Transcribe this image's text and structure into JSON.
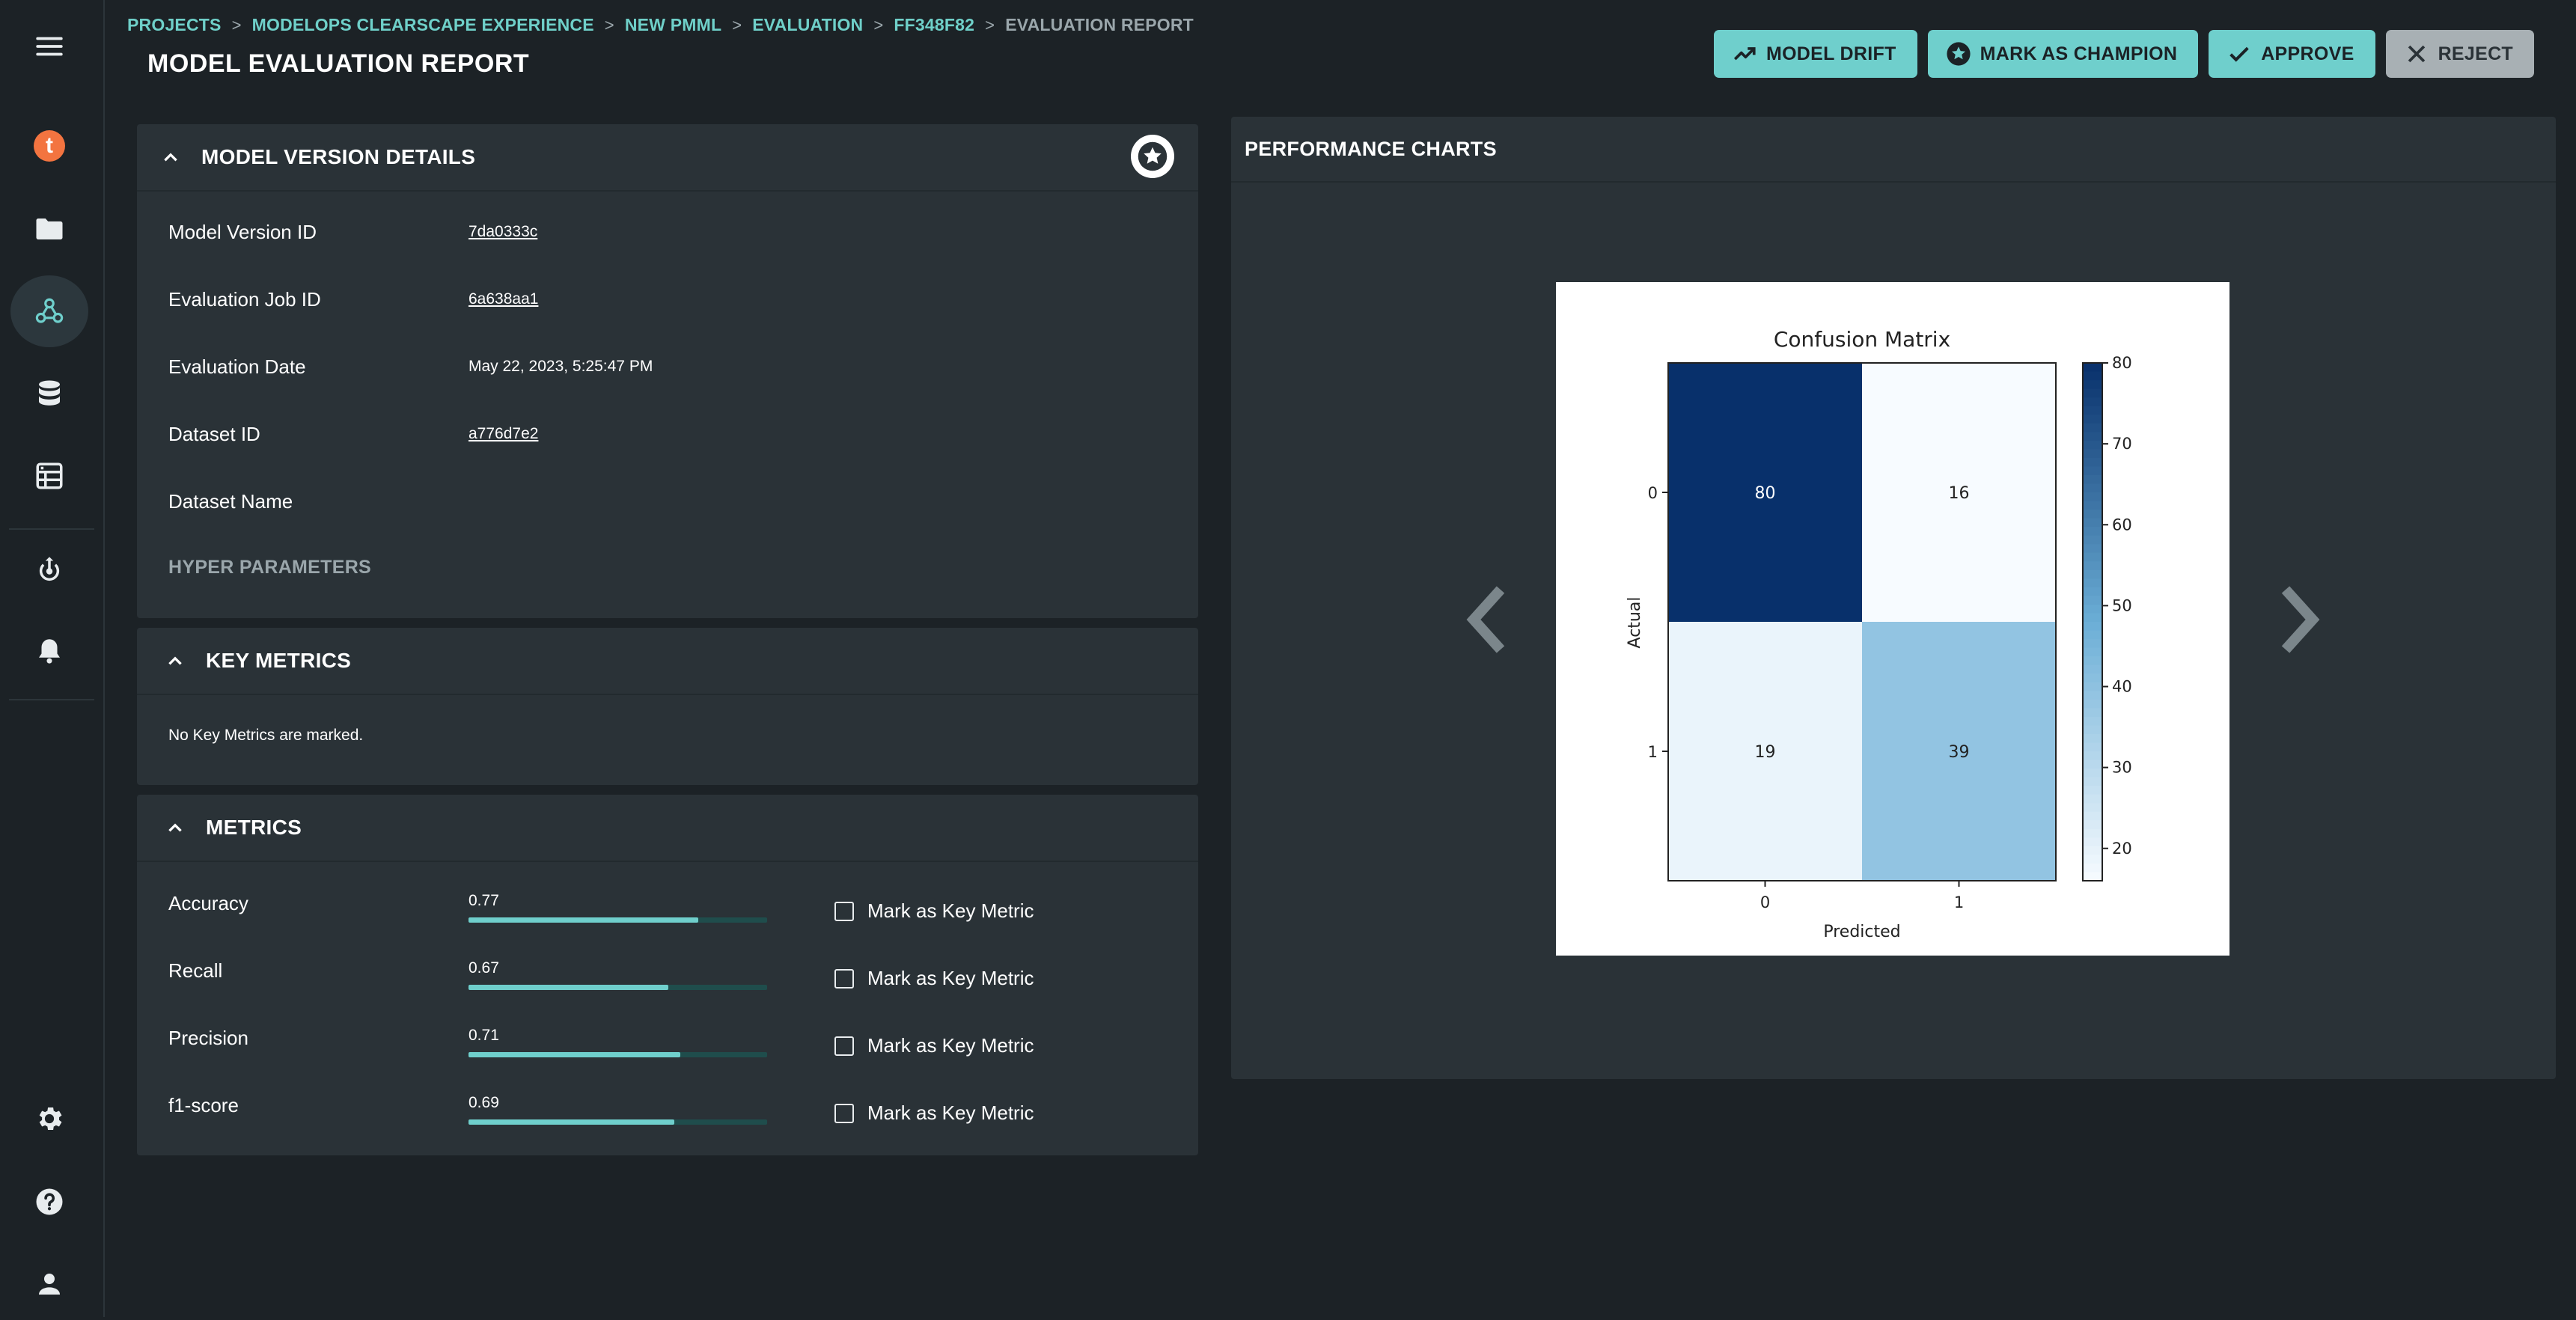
{
  "sidebar": {
    "menu_icon": "hamburger-icon",
    "brand_letter": "t",
    "items": [
      "menu-icon",
      "brand-logo",
      "folder-icon",
      "hub-icon",
      "database-icon",
      "dataset-table-icon",
      "deploy-icon",
      "bell-icon"
    ],
    "bottom": [
      "gear-icon",
      "help-icon",
      "user-icon"
    ]
  },
  "breadcrumb": {
    "items": [
      "PROJECTS",
      "MODELOPS CLEARSCAPE EXPERIENCE",
      "NEW PMML",
      "EVALUATION",
      "FF348F82"
    ],
    "current": "EVALUATION REPORT"
  },
  "page": {
    "title": "MODEL EVALUATION REPORT"
  },
  "actions": {
    "model_drift": "MODEL DRIFT",
    "mark_champion": "MARK AS CHAMPION",
    "approve": "APPROVE",
    "reject": "REJECT"
  },
  "details": {
    "title": "MODEL VERSION DETAILS",
    "rows": [
      {
        "label": "Model Version ID",
        "value": "7da0333c"
      },
      {
        "label": "Evaluation Job ID",
        "value": "6a638aa1"
      },
      {
        "label": "Evaluation Date",
        "value": "May 22, 2023, 5:25:47 PM"
      },
      {
        "label": "Dataset ID",
        "value": "a776d7e2"
      },
      {
        "label": "Dataset Name",
        "value": ""
      }
    ],
    "hyper_parameters": "HYPER PARAMETERS"
  },
  "key_metrics": {
    "title": "KEY METRICS",
    "empty_text": "No Key Metrics are marked."
  },
  "metrics": {
    "title": "METRICS",
    "checkbox_label": "Mark as Key Metric",
    "rows": [
      {
        "label": "Accuracy",
        "value": "0.77",
        "fraction": 0.77
      },
      {
        "label": "Recall",
        "value": "0.67",
        "fraction": 0.67
      },
      {
        "label": "Precision",
        "value": "0.71",
        "fraction": 0.71
      },
      {
        "label": "f1-score",
        "value": "0.69",
        "fraction": 0.69
      }
    ]
  },
  "performance": {
    "title": "PERFORMANCE CHARTS"
  },
  "colors": {
    "accent": "#6fcfcc",
    "background": "#1c2226",
    "panel": "#2a3237",
    "brand": "#f37440"
  },
  "chart_data": {
    "type": "heatmap",
    "title": "Confusion Matrix",
    "xlabel": "Predicted",
    "ylabel": "Actual",
    "x_categories": [
      "0",
      "1"
    ],
    "y_categories": [
      "0",
      "1"
    ],
    "values": [
      [
        80,
        16
      ],
      [
        19,
        39
      ]
    ],
    "colorbar_ticks": [
      "80",
      "70",
      "60",
      "50",
      "40",
      "30",
      "20"
    ],
    "colorbar_range": [
      16,
      80
    ]
  }
}
